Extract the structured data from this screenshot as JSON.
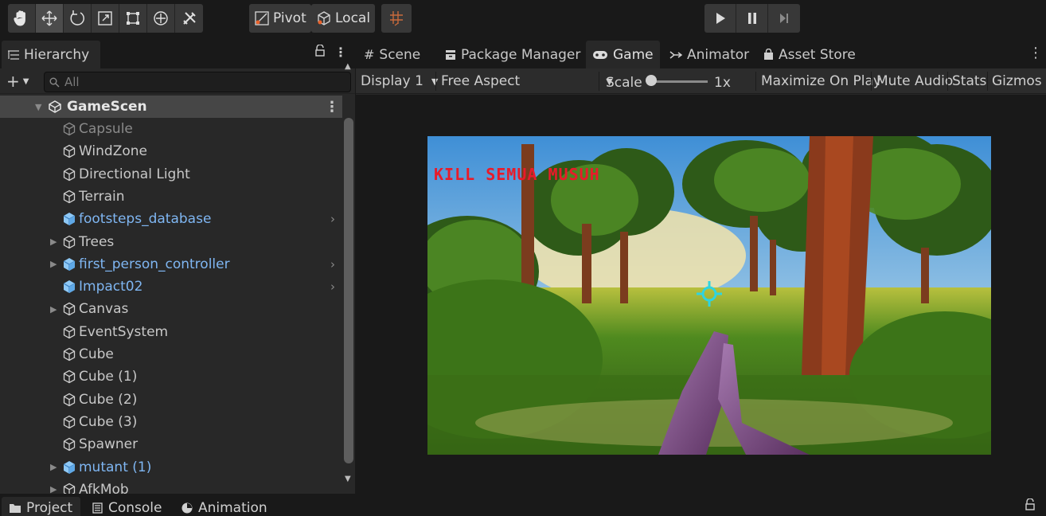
{
  "toolbar": {
    "tools": [
      {
        "name": "hand-icon",
        "glyph": "✋"
      },
      {
        "name": "move-tool-icon",
        "glyph": "✥"
      },
      {
        "name": "rotate-tool-icon",
        "glyph": "⟲"
      },
      {
        "name": "scale-tool-icon",
        "glyph": "⤢"
      },
      {
        "name": "rect-tool-icon",
        "glyph": "⬚"
      },
      {
        "name": "transform-tool-icon",
        "glyph": "⊕"
      },
      {
        "name": "custom-tool-icon",
        "glyph": "✂"
      }
    ],
    "pivot_label": "Pivot",
    "local_label": "Local",
    "playback": [
      "play-icon",
      "pause-icon",
      "step-icon"
    ]
  },
  "hierarchy": {
    "tab_label": "Hierarchy",
    "search_placeholder": "All",
    "scene_name": "GameScen",
    "items": [
      {
        "label": "Capsule",
        "style": "dim",
        "expandable": false,
        "prefab": false
      },
      {
        "label": "WindZone",
        "style": "normal",
        "expandable": false,
        "prefab": false
      },
      {
        "label": "Directional Light",
        "style": "normal",
        "expandable": false,
        "prefab": false
      },
      {
        "label": "Terrain",
        "style": "normal",
        "expandable": false,
        "prefab": false
      },
      {
        "label": "footsteps_database",
        "style": "blue",
        "expandable": false,
        "prefab": true
      },
      {
        "label": "Trees",
        "style": "normal",
        "expandable": true,
        "prefab": false
      },
      {
        "label": "first_person_controller",
        "style": "blue",
        "expandable": true,
        "prefab": true
      },
      {
        "label": "Impact02",
        "style": "blue",
        "expandable": false,
        "prefab": true
      },
      {
        "label": "Canvas",
        "style": "normal",
        "expandable": true,
        "prefab": false
      },
      {
        "label": "EventSystem",
        "style": "normal",
        "expandable": false,
        "prefab": false
      },
      {
        "label": "Cube",
        "style": "normal",
        "expandable": false,
        "prefab": false
      },
      {
        "label": "Cube (1)",
        "style": "normal",
        "expandable": false,
        "prefab": false
      },
      {
        "label": "Cube (2)",
        "style": "normal",
        "expandable": false,
        "prefab": false
      },
      {
        "label": "Cube (3)",
        "style": "normal",
        "expandable": false,
        "prefab": false
      },
      {
        "label": "Spawner",
        "style": "normal",
        "expandable": false,
        "prefab": false
      },
      {
        "label": "mutant (1)",
        "style": "blue",
        "expandable": true,
        "prefab": true
      },
      {
        "label": "AfkMob",
        "style": "normal",
        "expandable": true,
        "prefab": false
      }
    ]
  },
  "game_tabs": [
    {
      "label": "Scene",
      "icon": "#"
    },
    {
      "label": "Package Manager",
      "icon": "▬"
    },
    {
      "label": "Game",
      "icon": "●●"
    },
    {
      "label": "Animator",
      "icon": "⤳"
    },
    {
      "label": "Asset Store",
      "icon": "■"
    }
  ],
  "game_options": {
    "display": "Display 1",
    "aspect": "Free Aspect",
    "scale_label": "Scale",
    "scale_value": "1x",
    "maximize": "Maximize On Play",
    "mute": "Mute Audio",
    "stats": "Stats",
    "gizmos": "Gizmos"
  },
  "game_view": {
    "hud_text": "KILL SEMUA MUSUH",
    "hud_color": "#e81b2a",
    "crosshair_color": "#2fd4e0"
  },
  "bottom_tabs": [
    {
      "label": "Project",
      "icon": "folder-icon"
    },
    {
      "label": "Console",
      "icon": "console-icon"
    },
    {
      "label": "Animation",
      "icon": "animation-icon"
    }
  ]
}
